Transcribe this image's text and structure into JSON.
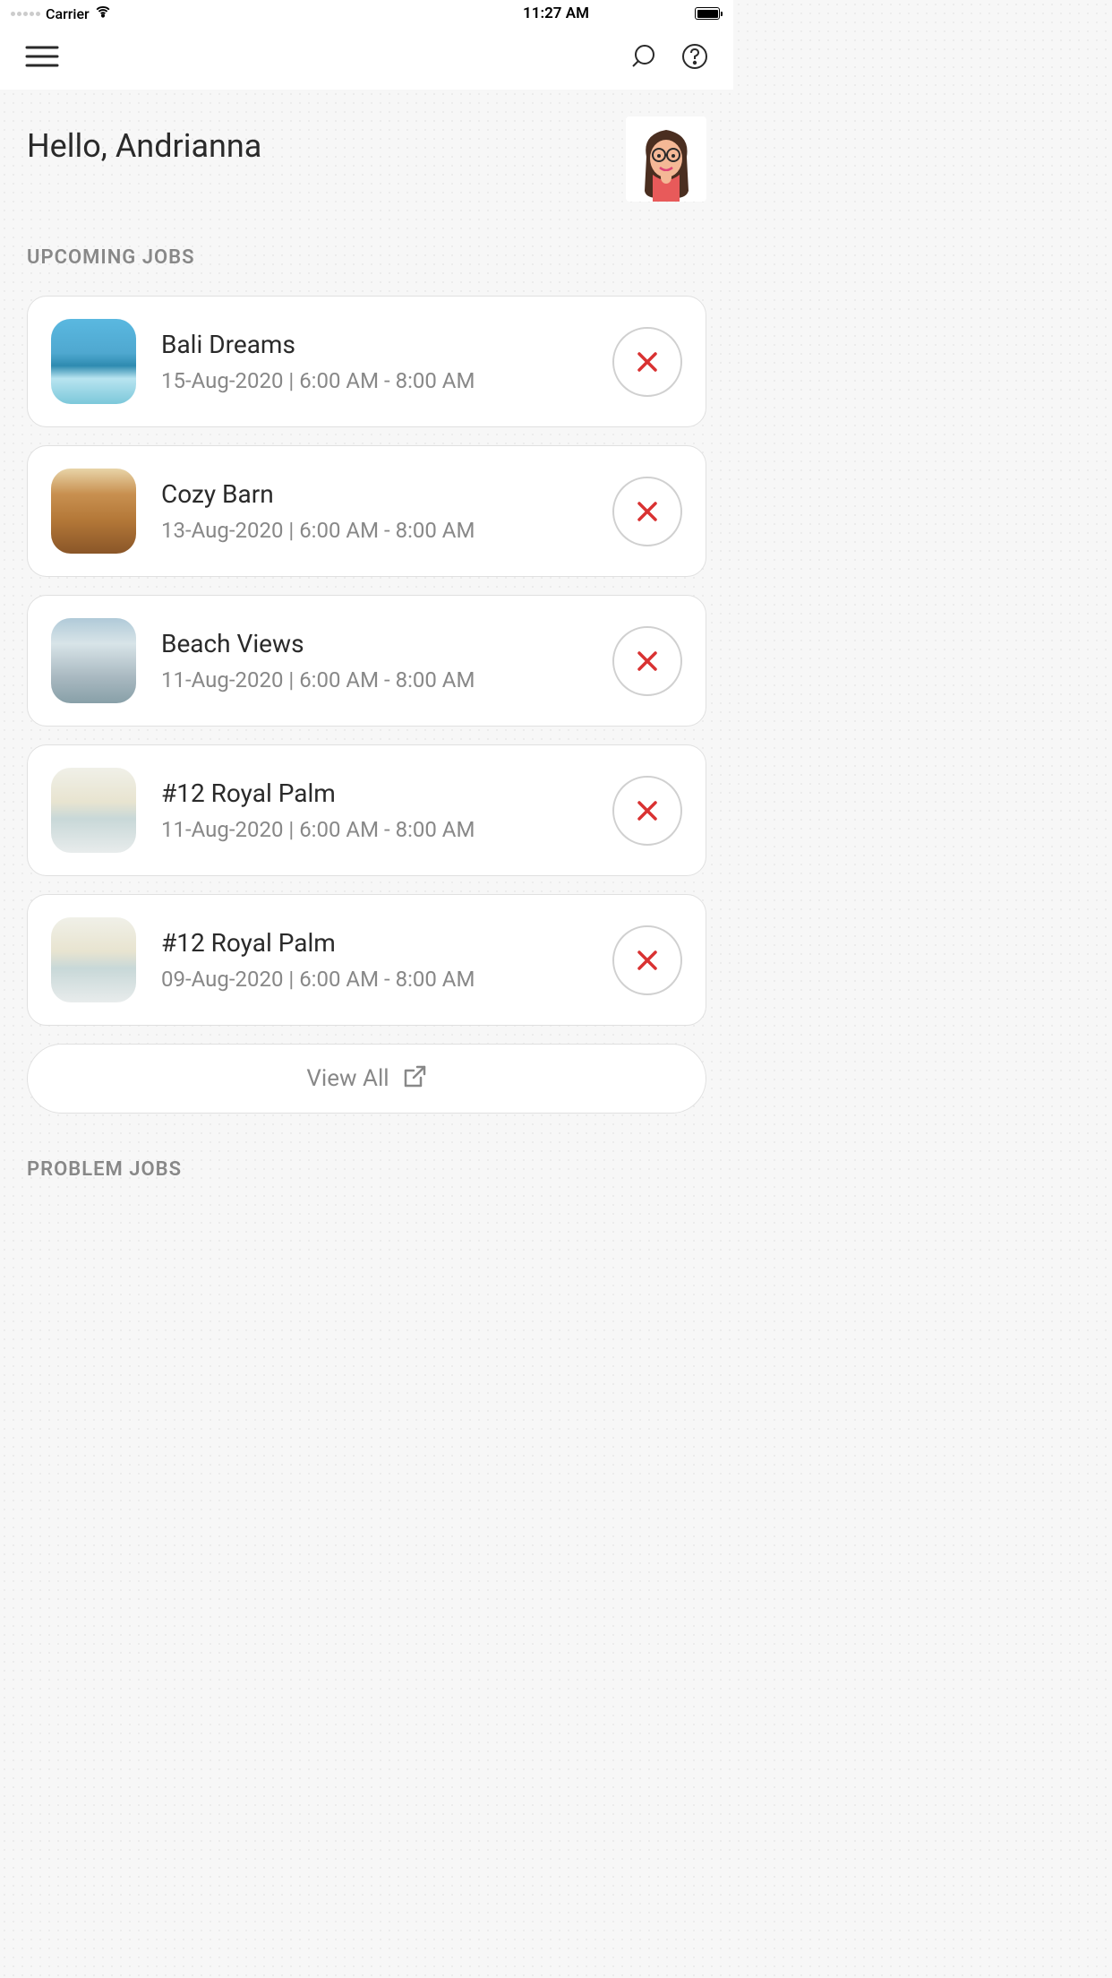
{
  "status_bar": {
    "carrier": "Carrier",
    "time": "11:27 AM"
  },
  "greeting": "Hello, Andrianna",
  "sections": {
    "upcoming_title": "UPCOMING JOBS",
    "problem_title": "PROBLEM JOBS"
  },
  "jobs": [
    {
      "title": "Bali Dreams",
      "date": "15-Aug-2020",
      "time": "6:00 AM - 8:00 AM",
      "thumb": "bali"
    },
    {
      "title": "Cozy Barn",
      "date": "13-Aug-2020",
      "time": "6:00 AM - 8:00 AM",
      "thumb": "barn"
    },
    {
      "title": "Beach Views",
      "date": "11-Aug-2020",
      "time": "6:00 AM - 8:00 AM",
      "thumb": "beach"
    },
    {
      "title": "#12 Royal Palm",
      "date": "11-Aug-2020",
      "time": "6:00 AM - 8:00 AM",
      "thumb": "palm"
    },
    {
      "title": "#12 Royal Palm",
      "date": "09-Aug-2020",
      "time": "6:00 AM - 8:00 AM",
      "thumb": "palm"
    }
  ],
  "view_all": "View All"
}
